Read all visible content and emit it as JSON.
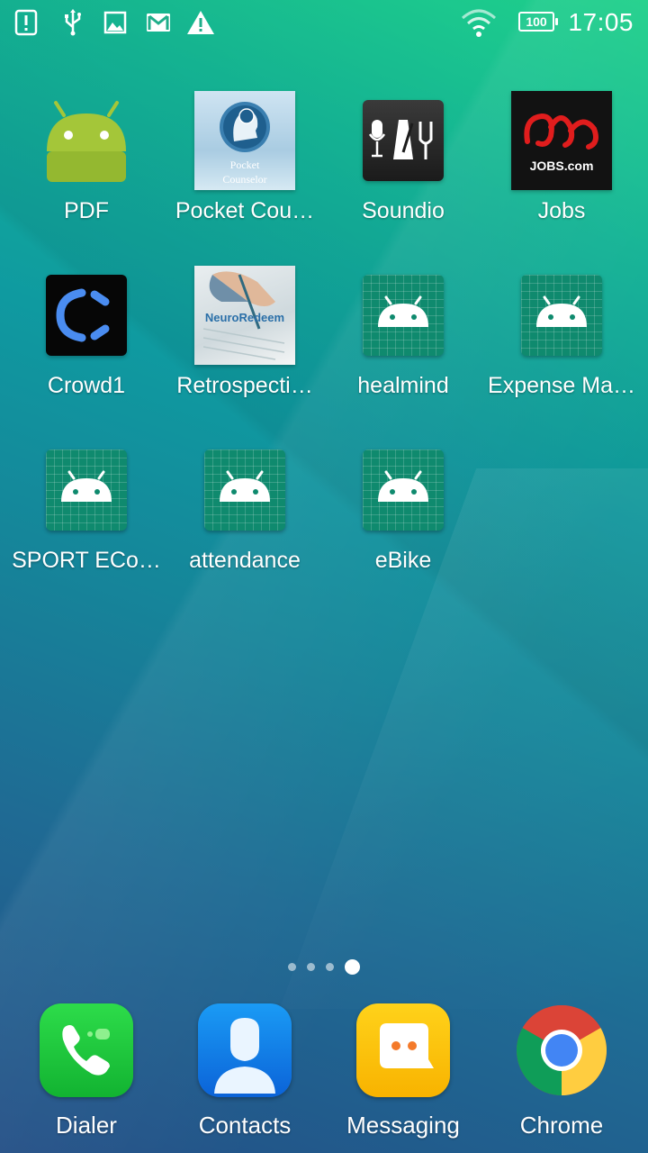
{
  "status_bar": {
    "time": "17:05",
    "battery": "100",
    "icons": [
      "notification-alert-icon",
      "usb-icon",
      "image-icon",
      "gmail-icon",
      "warning-icon",
      "wifi-icon",
      "battery-icon"
    ]
  },
  "apps": [
    {
      "label": "PDF",
      "icon": "android-robot-icon"
    },
    {
      "label": "Pocket Cou…",
      "icon": "pocket-counselor-icon",
      "icon_text": "Pocket Counselor"
    },
    {
      "label": "Soundio",
      "icon": "soundio-icon"
    },
    {
      "label": "Jobs",
      "icon": "jobs-icon",
      "icon_text": "JOBS.com"
    },
    {
      "label": "Crowd1",
      "icon": "crowd1-icon"
    },
    {
      "label": "Retrospecti…",
      "icon": "neuroredeem-icon",
      "icon_text": "NeuroRedeem"
    },
    {
      "label": "healmind",
      "icon": "android-placeholder-icon"
    },
    {
      "label": "Expense Ma…",
      "icon": "android-placeholder-icon"
    },
    {
      "label": "SPORT ECo…",
      "icon": "android-placeholder-icon"
    },
    {
      "label": "attendance",
      "icon": "android-placeholder-icon"
    },
    {
      "label": "eBike",
      "icon": "android-placeholder-icon"
    }
  ],
  "page_indicator": {
    "count": 4,
    "active": 4
  },
  "dock": [
    {
      "label": "Dialer",
      "icon": "phone-icon"
    },
    {
      "label": "Contacts",
      "icon": "contacts-icon"
    },
    {
      "label": "Messaging",
      "icon": "messaging-icon"
    },
    {
      "label": "Chrome",
      "icon": "chrome-icon"
    }
  ],
  "colors": {
    "wallpaper_top": "#1fd08a",
    "wallpaper_bottom": "#234f86",
    "placeholder_green": "#0f8a6e",
    "android_green": "#a4c639"
  }
}
